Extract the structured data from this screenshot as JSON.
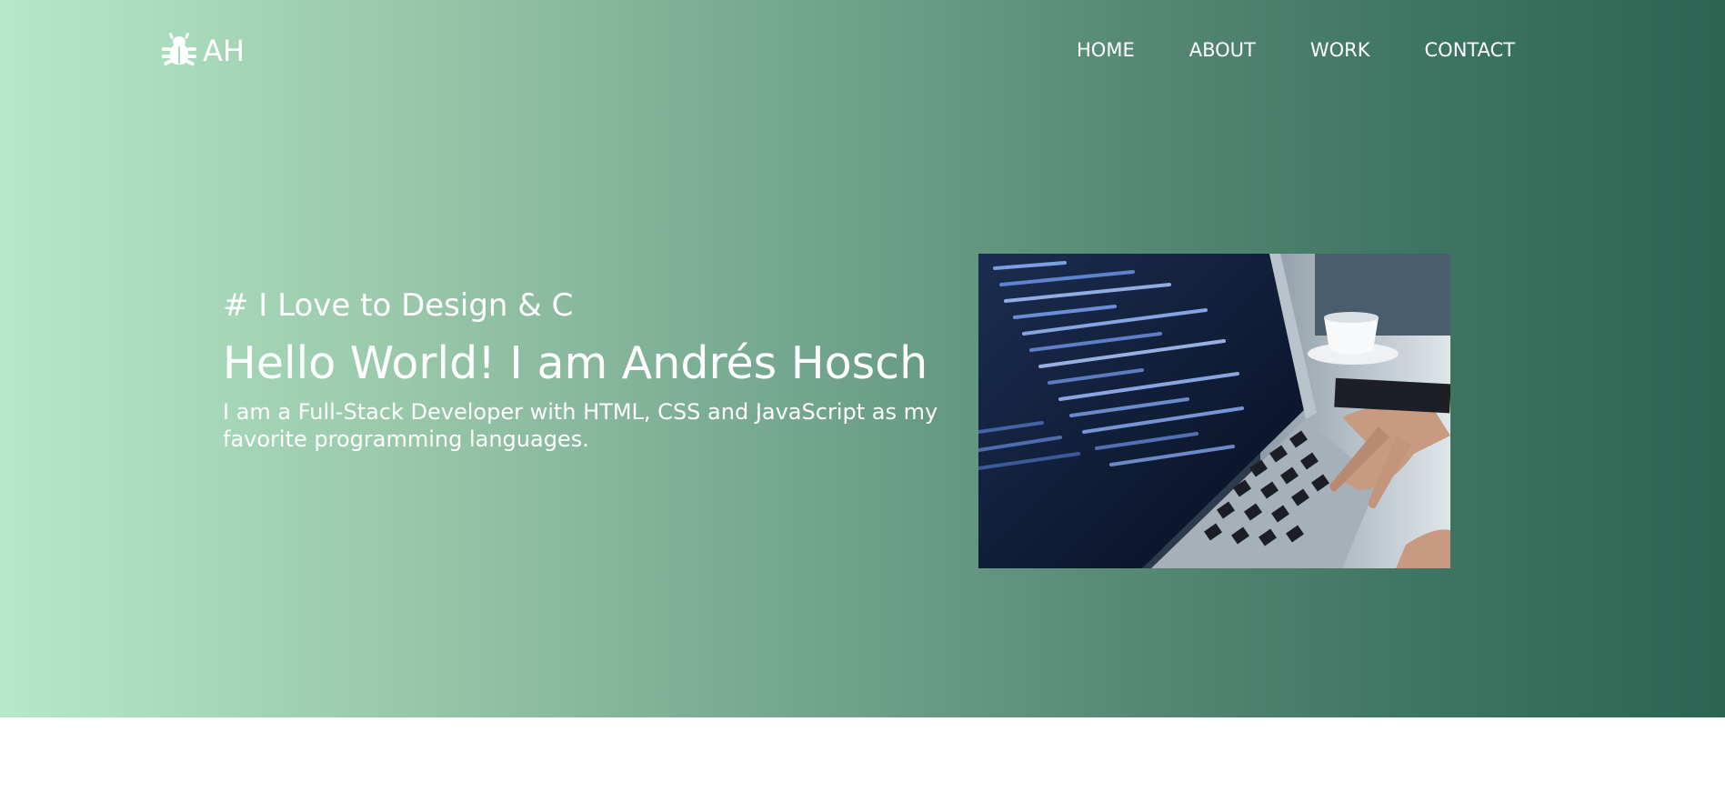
{
  "logo": {
    "icon": "bug-icon",
    "text": "AH"
  },
  "nav": {
    "items": [
      {
        "label": "HOME"
      },
      {
        "label": "ABOUT"
      },
      {
        "label": "WORK"
      },
      {
        "label": "CONTACT"
      }
    ]
  },
  "hero": {
    "tagline": "# I Love to Design & C",
    "headline": "Hello World! I am Andrés Hosch",
    "subtitle": "I am a Full-Stack Developer with HTML, CSS and JavaScript as my favorite programming languages.",
    "image": "laptop-code-photo"
  },
  "colors": {
    "gradient_start": "#b5e9c9",
    "gradient_end": "#2c6352",
    "text": "#ffffff",
    "page_background": "#ffffff"
  }
}
